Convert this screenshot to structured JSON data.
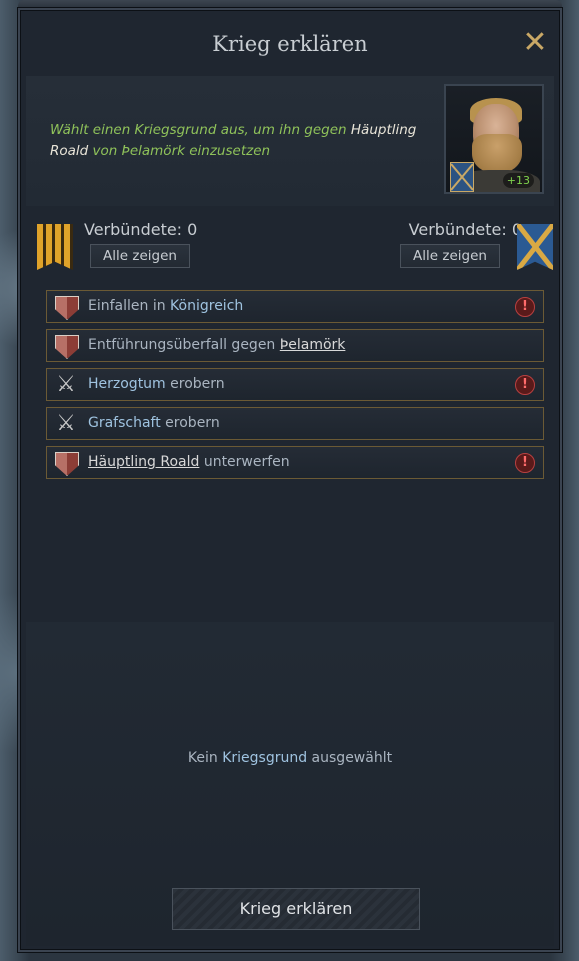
{
  "window": {
    "title": "Krieg erklären",
    "close_label": "✕"
  },
  "description": {
    "prefix": "Wählt einen Kriegsgrund aus, um ihn gegen ",
    "target": "Häuptling Roald",
    "suffix": " von Þelamörk einzusetzen"
  },
  "portrait": {
    "opinion": "+13"
  },
  "allies": {
    "left_label": "Verbündete: 0",
    "right_label": "Verbündete: 0",
    "show_all": "Alle zeigen"
  },
  "casus_belli": [
    {
      "icon": "shield-icon",
      "prefix": "Einfallen in ",
      "highlight": "Königreich",
      "underline": "",
      "suffix": "",
      "warning": true
    },
    {
      "icon": "shield-icon",
      "prefix": "Entführungsüberfall gegen ",
      "highlight": "",
      "underline": "Þelamörk",
      "suffix": "",
      "warning": false
    },
    {
      "icon": "crossed-swords-icon",
      "prefix": "",
      "highlight": "Herzogtum",
      "underline": "",
      "suffix": " erobern",
      "warning": true
    },
    {
      "icon": "crossed-swords-icon",
      "prefix": "",
      "highlight": "Grafschaft",
      "underline": "",
      "suffix": " erobern",
      "warning": false
    },
    {
      "icon": "shield-icon",
      "prefix": "",
      "highlight": "",
      "underline": "Häuptling Roald",
      "suffix": " unterwerfen",
      "warning": true
    }
  ],
  "empty_state": {
    "prefix": "Kein ",
    "highlight": "Kriegsgrund",
    "suffix": " ausgewählt"
  },
  "declare_button": "Krieg erklären",
  "colors": {
    "accent_gold": "#c9a866",
    "positive_green": "#8fc25a",
    "warning_red": "#b84040"
  }
}
